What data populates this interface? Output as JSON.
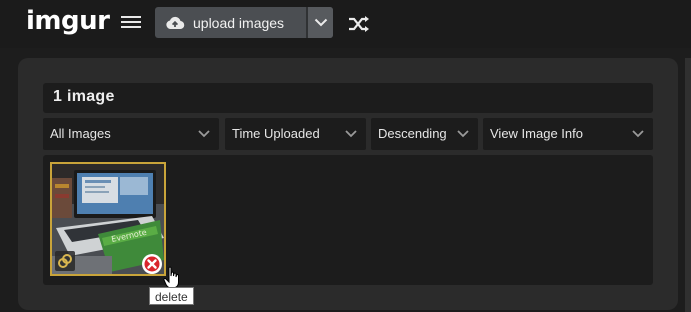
{
  "header": {
    "logo": "imgur",
    "upload_label": "upload images"
  },
  "gallery": {
    "count_label": "1 image",
    "filters": [
      {
        "selected": "All Images"
      },
      {
        "selected": "Time Uploaded"
      },
      {
        "selected": "Descending"
      },
      {
        "selected": "View Image Info"
      }
    ]
  },
  "tooltip": {
    "text": "delete"
  },
  "icons": {
    "menu": "hamburger-icon",
    "upload": "cloud-upload-icon",
    "caret": "chevron-down-icon",
    "random": "shuffle-icon",
    "delete": "delete-x-icon"
  },
  "colors": {
    "background": "#1d1d1d",
    "panel": "#2b2b2b",
    "thumb_border": "#c9a43a",
    "delete_red": "#d9252c"
  }
}
